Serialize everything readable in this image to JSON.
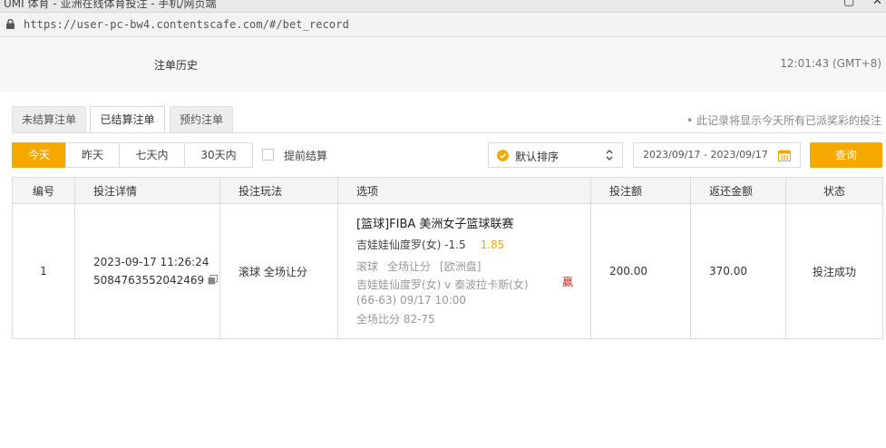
{
  "browser": {
    "window_title": "UMI 体育 - 亚洲在线体育投注 - 手机/网页端",
    "url": "https://user-pc-bw4.contentscafe.com/#/bet_record"
  },
  "header": {
    "title": "注单历史",
    "clock": "12:01:43 (GMT+8)"
  },
  "tabs": [
    {
      "label": "未结算注单",
      "active": false
    },
    {
      "label": "已结算注单",
      "active": true
    },
    {
      "label": "预约注单",
      "active": false
    }
  ],
  "notice": "• 此记录将显示今天所有已派奖彩的投注",
  "filters": {
    "ranges": [
      {
        "label": "今天",
        "active": true
      },
      {
        "label": "昨天",
        "active": false
      },
      {
        "label": "七天内",
        "active": false
      },
      {
        "label": "30天内",
        "active": false
      }
    ],
    "early_settle_label": "提前结算",
    "sort_label": "默认排序",
    "date_range": "2023/09/17 - 2023/09/17",
    "query_label": "查询"
  },
  "colors": {
    "accent": "#f5a800",
    "return_red": "#c0261f"
  },
  "table": {
    "headers": [
      "编号",
      "投注详情",
      "投注玩法",
      "选项",
      "投注额",
      "返还金额",
      "状态"
    ],
    "rows": [
      {
        "index": "1",
        "bet_time": "2023-09-17 11:26:24",
        "bet_id": "5084763552042469",
        "play_type": "滚球 全场让分",
        "league": "[篮球]FIBA 美洲女子篮球联赛",
        "pick": "吉娃娃仙度罗(女) -1.5",
        "odds": "1.85",
        "tags": [
          "滚球",
          "全场让分",
          "[欧洲盘]"
        ],
        "result": "赢",
        "teams": "吉娃娃仙度罗(女) v 泰波拉卡斯(女) (66-63)   09/17 10:00",
        "final_score": "全场比分 82-75",
        "stake": "200.00",
        "return_amount": "370.00",
        "status": "投注成功"
      }
    ]
  }
}
